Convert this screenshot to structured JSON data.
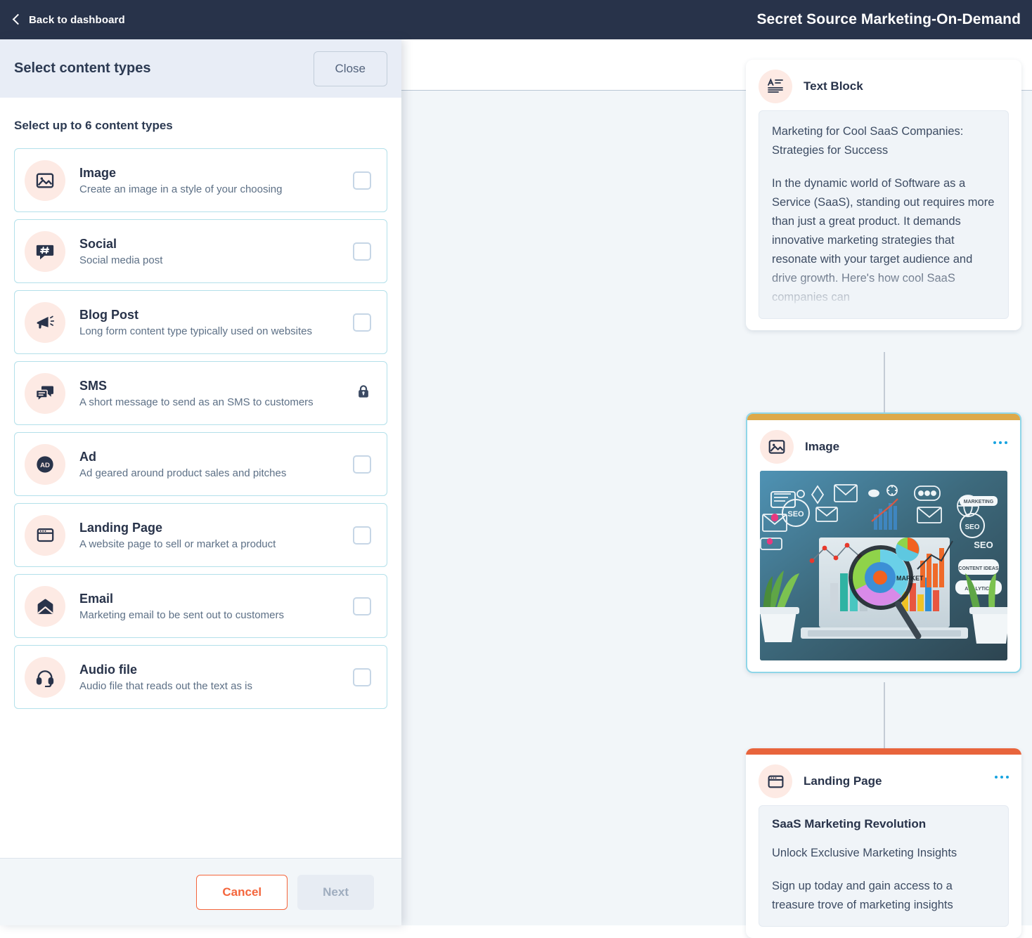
{
  "topbar": {
    "back_label": "Back to dashboard",
    "back_icon": "chevron-left-icon",
    "title": "Secret Source Marketing-On-Demand",
    "background": "#28334a"
  },
  "panel": {
    "header_title": "Select content types",
    "close_label": "Close",
    "subtitle": "Select up to 6 content types",
    "content_types": [
      {
        "name": "Image",
        "description": "Create an image in a style of your choosing",
        "icon": "image-icon",
        "control": "checkbox",
        "checked": false
      },
      {
        "name": "Social",
        "description": "Social media post",
        "icon": "hashtag-bubble-icon",
        "control": "checkbox",
        "checked": false
      },
      {
        "name": "Blog Post",
        "description": "Long form content type typically used on websites",
        "icon": "megaphone-icon",
        "control": "checkbox",
        "checked": false
      },
      {
        "name": "SMS",
        "description": "A short message to send as an SMS to customers",
        "icon": "chat-bubbles-icon",
        "control": "lock",
        "checked": false
      },
      {
        "name": "Ad",
        "description": "Ad geared around product sales and pitches",
        "icon": "ad-badge-icon",
        "control": "checkbox",
        "checked": false
      },
      {
        "name": "Landing Page",
        "description": "A website page to sell or market a product",
        "icon": "browser-window-icon",
        "control": "checkbox",
        "checked": false
      },
      {
        "name": "Email",
        "description": "Marketing email to be sent out to customers",
        "icon": "envelope-icon",
        "control": "checkbox",
        "checked": false
      },
      {
        "name": "Audio file",
        "description": "Audio file that reads out the text as is",
        "icon": "headset-icon",
        "control": "checkbox",
        "checked": false
      }
    ],
    "footer": {
      "cancel_label": "Cancel",
      "next_label": "Next",
      "next_disabled": true
    }
  },
  "canvas": {
    "cards": [
      {
        "title": "Text Block",
        "icon": "text-block-icon",
        "accent_color": "none",
        "selected": false,
        "menu_icon": "ellipsis-icon",
        "body_type": "text",
        "paragraphs": [
          "Marketing for Cool SaaS Companies: Strategies for Success",
          "In the dynamic world of Software as a Service (SaaS), standing out requires more than just a great product. It demands innovative marketing strategies that resonate with your target audience and drive growth. Here's how cool SaaS companies can"
        ]
      },
      {
        "title": "Image",
        "icon": "image-icon",
        "accent_color": "#dda94a",
        "selected": true,
        "menu_icon": "ellipsis-icon",
        "body_type": "image",
        "image_alt": "Marketing concept illustration with laptop, charts, SEO icons, envelopes and plants"
      },
      {
        "title": "Landing Page",
        "icon": "browser-window-icon",
        "accent_color": "#e8643c",
        "selected": false,
        "menu_icon": "ellipsis-icon",
        "body_type": "text",
        "heading": "SaaS Marketing Revolution",
        "paragraphs": [
          "Unlock Exclusive Marketing Insights",
          "Sign up today and gain access to a treasure trove of marketing insights"
        ]
      }
    ]
  },
  "colors": {
    "accent_orange": "#f4653c",
    "accent_gold": "#dda94a",
    "accent_blue": "#17a3e0",
    "selected_border": "#8fd6e8",
    "navy": "#28334a",
    "icon_bg": "#fdeae4"
  }
}
